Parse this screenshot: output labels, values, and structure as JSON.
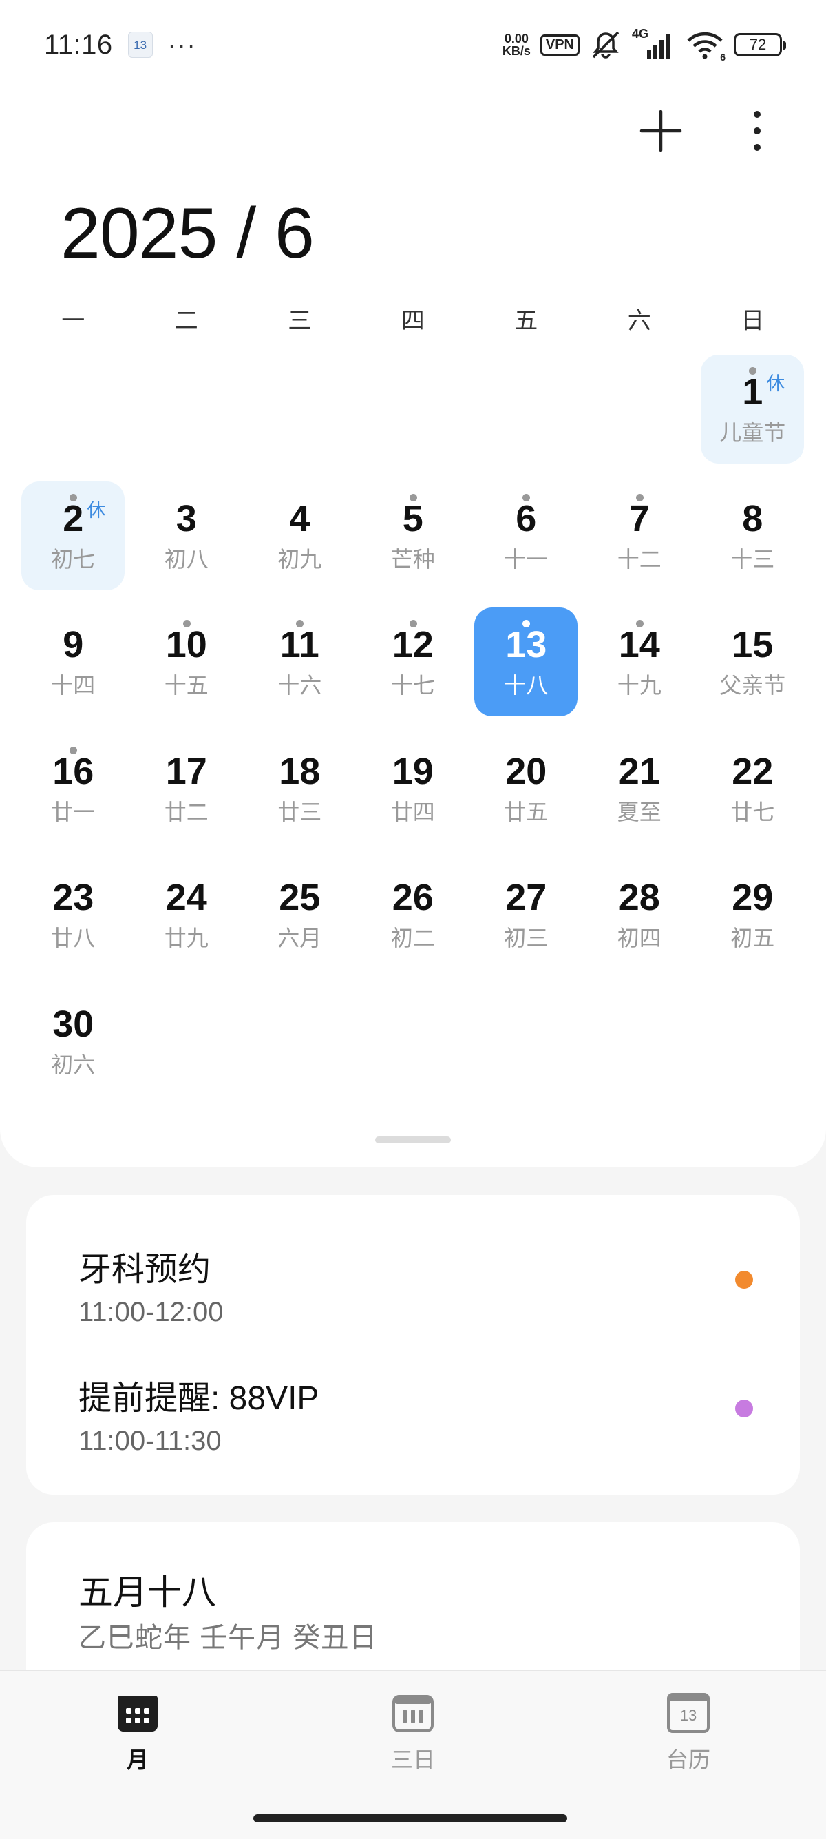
{
  "status_bar": {
    "time": "11:16",
    "cal_icon_day": "13",
    "more": "···",
    "speed_top": "0.00",
    "speed_bottom": "KB/s",
    "vpn": "VPN",
    "network": "4G",
    "wifi_sub": "6",
    "battery": "72"
  },
  "header": {
    "title": "2025 / 6",
    "add_icon": "plus-icon",
    "more_icon": "more-vertical-icon"
  },
  "weekdays": [
    "一",
    "二",
    "三",
    "四",
    "五",
    "六",
    "日"
  ],
  "days": [
    {
      "d": "1",
      "lunar": "儿童节",
      "col": 6,
      "row": 0,
      "rest": "休",
      "dot": true,
      "holiday": true
    },
    {
      "d": "2",
      "lunar": "初七",
      "col": 0,
      "row": 1,
      "rest": "休",
      "dot": true,
      "holiday": true
    },
    {
      "d": "3",
      "lunar": "初八",
      "col": 1,
      "row": 1
    },
    {
      "d": "4",
      "lunar": "初九",
      "col": 2,
      "row": 1
    },
    {
      "d": "5",
      "lunar": "芒种",
      "col": 3,
      "row": 1,
      "dot": true
    },
    {
      "d": "6",
      "lunar": "十一",
      "col": 4,
      "row": 1,
      "dot": true
    },
    {
      "d": "7",
      "lunar": "十二",
      "col": 5,
      "row": 1,
      "dot": true
    },
    {
      "d": "8",
      "lunar": "十三",
      "col": 6,
      "row": 1
    },
    {
      "d": "9",
      "lunar": "十四",
      "col": 0,
      "row": 2
    },
    {
      "d": "10",
      "lunar": "十五",
      "col": 1,
      "row": 2,
      "dot": true
    },
    {
      "d": "11",
      "lunar": "十六",
      "col": 2,
      "row": 2,
      "dot": true
    },
    {
      "d": "12",
      "lunar": "十七",
      "col": 3,
      "row": 2,
      "dot": true
    },
    {
      "d": "13",
      "lunar": "十八",
      "col": 4,
      "row": 2,
      "dot": true,
      "today": true
    },
    {
      "d": "14",
      "lunar": "十九",
      "col": 5,
      "row": 2,
      "dot": true
    },
    {
      "d": "15",
      "lunar": "父亲节",
      "col": 6,
      "row": 2
    },
    {
      "d": "16",
      "lunar": "廿一",
      "col": 0,
      "row": 3,
      "dot": true
    },
    {
      "d": "17",
      "lunar": "廿二",
      "col": 1,
      "row": 3
    },
    {
      "d": "18",
      "lunar": "廿三",
      "col": 2,
      "row": 3
    },
    {
      "d": "19",
      "lunar": "廿四",
      "col": 3,
      "row": 3
    },
    {
      "d": "20",
      "lunar": "廿五",
      "col": 4,
      "row": 3
    },
    {
      "d": "21",
      "lunar": "夏至",
      "col": 5,
      "row": 3
    },
    {
      "d": "22",
      "lunar": "廿七",
      "col": 6,
      "row": 3
    },
    {
      "d": "23",
      "lunar": "廿八",
      "col": 0,
      "row": 4
    },
    {
      "d": "24",
      "lunar": "廿九",
      "col": 1,
      "row": 4
    },
    {
      "d": "25",
      "lunar": "六月",
      "col": 2,
      "row": 4
    },
    {
      "d": "26",
      "lunar": "初二",
      "col": 3,
      "row": 4
    },
    {
      "d": "27",
      "lunar": "初三",
      "col": 4,
      "row": 4
    },
    {
      "d": "28",
      "lunar": "初四",
      "col": 5,
      "row": 4
    },
    {
      "d": "29",
      "lunar": "初五",
      "col": 6,
      "row": 4
    },
    {
      "d": "30",
      "lunar": "初六",
      "col": 0,
      "row": 5
    }
  ],
  "events": [
    {
      "title": "牙科预约",
      "time": "11:00-12:00",
      "color": "#f28a2e"
    },
    {
      "title": "提前提醒: 88VIP",
      "time": "11:00-11:30",
      "color": "#c77be0"
    }
  ],
  "lunar_info": {
    "date": "五月十八",
    "year": "乙巳蛇年 壬午月 癸丑日"
  },
  "nav": {
    "month": "月",
    "three_day": "三日",
    "almanac": "台历",
    "almanac_icon_day": "13"
  },
  "colors": {
    "accent": "#4b9cf6",
    "holiday_bg": "#eaf4fc",
    "rest_text": "#3d8be0"
  }
}
